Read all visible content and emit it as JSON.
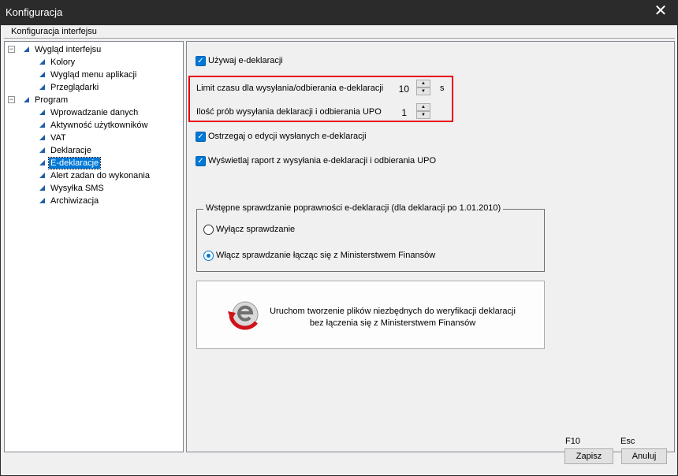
{
  "window": {
    "title": "Konfiguracja",
    "close_glyph": "✕"
  },
  "header": {
    "label": "Konfiguracja interfejsu"
  },
  "tree": {
    "items": [
      {
        "label": "Wygląd interfejsu",
        "level": 0,
        "expander": "−"
      },
      {
        "label": "Kolory",
        "level": 1
      },
      {
        "label": "Wygląd menu aplikacji",
        "level": 1
      },
      {
        "label": "Przeglądarki",
        "level": 1
      },
      {
        "label": "Program",
        "level": 0,
        "expander": "−"
      },
      {
        "label": "Wprowadzanie danych",
        "level": 1
      },
      {
        "label": "Aktywność użytkowników",
        "level": 1
      },
      {
        "label": "VAT",
        "level": 1
      },
      {
        "label": "Deklaracje",
        "level": 1
      },
      {
        "label": "E-deklaracje",
        "level": 1,
        "selected": true
      },
      {
        "label": "Alert zadan do wykonania",
        "level": 1
      },
      {
        "label": "Wysyłka SMS",
        "level": 1
      },
      {
        "label": "Archiwizacja",
        "level": 1
      }
    ]
  },
  "settings": {
    "use_edeclarations": {
      "label": "Używaj e-deklaracji",
      "checked": true
    },
    "time_limit": {
      "label": "Limit czasu dla wysyłania/odbierania e-deklaracji",
      "value": "10",
      "unit": "s"
    },
    "attempts": {
      "label": "Ilość prób wysyłania deklaracji i odbierania UPO",
      "value": "1"
    },
    "warn_edit": {
      "label": "Ostrzegaj o edycji wysłanych e-deklaracji",
      "checked": true
    },
    "show_report": {
      "label": "Wyświetlaj raport z wysyłania e-deklaracji i odbierania UPO",
      "checked": true
    },
    "validation_group": {
      "legend": "Wstępne sprawdzanie poprawności e-deklaracji (dla deklaracji po 1.01.2010)",
      "option_off": "Wyłącz sprawdzanie",
      "option_on": "Włącz sprawdzanie łącząc się z Ministerstwem Finansów",
      "selected": "option_on"
    },
    "generate_files": {
      "line1": "Uruchom tworzenie plików niezbędnych do weryfikacji deklaracji",
      "line2": "bez łączenia się z Ministerstwem Finansów",
      "icon": "e-declaration-refresh-icon"
    }
  },
  "footer": {
    "save_hint": "F10",
    "save_label": "Zapisz",
    "cancel_hint": "Esc",
    "cancel_label": "Anuluj"
  },
  "colors": {
    "accent": "#0078d7",
    "highlight_border": "#e8000e",
    "titlebar": "#2b2b2b"
  }
}
